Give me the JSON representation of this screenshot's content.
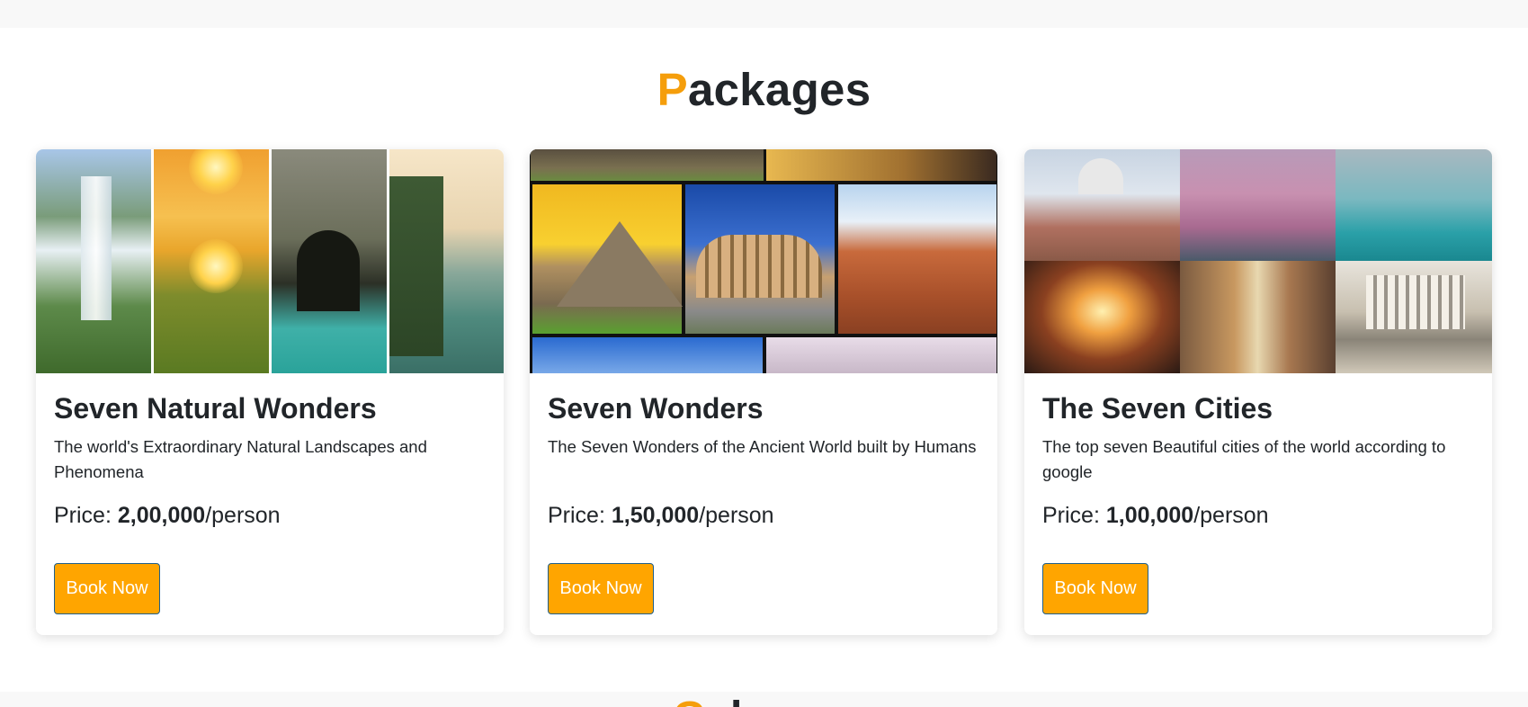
{
  "section": {
    "title_first": "P",
    "title_rest": "ackages"
  },
  "next_section": {
    "title_first": "G",
    "title_rest": "al"
  },
  "packages": [
    {
      "title": "Seven Natural Wonders",
      "description": "The world's Extraordinary Natural Landscapes and Phenomena",
      "price_label": "Price: ",
      "price_value": "2,00,000",
      "price_unit": "/person",
      "button_label": "Book Now"
    },
    {
      "title": "Seven Wonders",
      "description": "The Seven Wonders of the Ancient World built by Humans",
      "price_label": "Price: ",
      "price_value": "1,50,000",
      "price_unit": "/person",
      "button_label": "Book Now"
    },
    {
      "title": "The Seven Cities",
      "description": "The top seven Beautiful cities of the world according to google",
      "price_label": "Price: ",
      "price_value": "1,00,000",
      "price_unit": "/person",
      "button_label": "Book Now"
    }
  ],
  "colors": {
    "accent": "#f59e0b",
    "button_bg": "#ffa500",
    "button_border": "#1f5f8b"
  }
}
